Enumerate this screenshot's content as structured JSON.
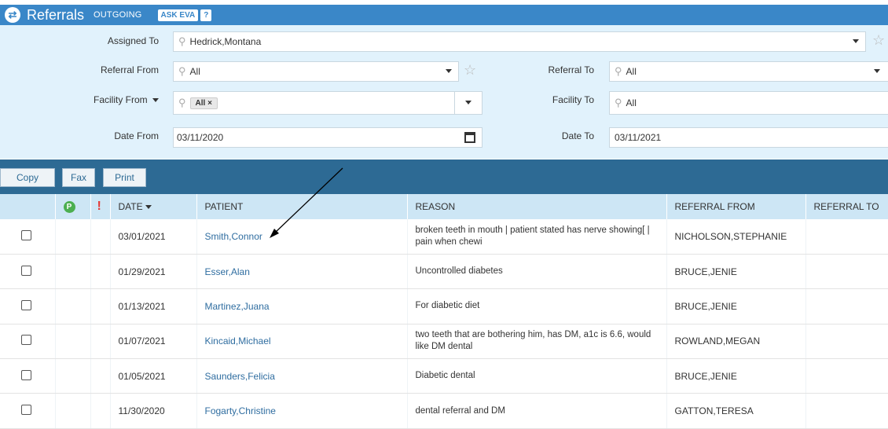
{
  "header": {
    "title": "Referrals",
    "subtitle": "OUTGOING",
    "ask_label": "ASK EVA",
    "help_label": "?",
    "accent": "#3a87c8"
  },
  "filters": {
    "assigned_to": {
      "label": "Assigned To",
      "value": "Hedrick,Montana"
    },
    "referral_from": {
      "label": "Referral From",
      "value": "All"
    },
    "referral_to": {
      "label": "Referral To",
      "value": "All"
    },
    "facility_from": {
      "label": "Facility From",
      "chip": "All"
    },
    "facility_to": {
      "label": "Facility To",
      "value": "All"
    },
    "date_from": {
      "label": "Date From",
      "value": "03/11/2020"
    },
    "date_to": {
      "label": "Date To",
      "value": "03/11/2021"
    }
  },
  "toolbar": {
    "copy": "Copy",
    "fax": "Fax",
    "print": "Print"
  },
  "table": {
    "columns": {
      "priority": "P",
      "urgent": "!",
      "date": "DATE",
      "patient": "PATIENT",
      "reason": "REASON",
      "referral_from": "REFERRAL FROM",
      "referral_to": "REFERRAL TO"
    },
    "rows": [
      {
        "date": "03/01/2021",
        "patient": "Smith,Connor",
        "reason": "broken teeth in mouth | patient stated has nerve showing[ | pain when chewi",
        "referral_from": "NICHOLSON,STEPHANIE",
        "referral_to": ""
      },
      {
        "date": "01/29/2021",
        "patient": "Esser,Alan",
        "reason": "Uncontrolled diabetes",
        "referral_from": "BRUCE,JENIE",
        "referral_to": ""
      },
      {
        "date": "01/13/2021",
        "patient": "Martinez,Juana",
        "reason": "For diabetic diet",
        "referral_from": "BRUCE,JENIE",
        "referral_to": ""
      },
      {
        "date": "01/07/2021",
        "patient": "Kincaid,Michael",
        "reason": "two teeth that are bothering him, has DM, a1c is 6.6, would like DM dental",
        "referral_from": "ROWLAND,MEGAN",
        "referral_to": ""
      },
      {
        "date": "01/05/2021",
        "patient": "Saunders,Felicia",
        "reason": "Diabetic dental",
        "referral_from": "BRUCE,JENIE",
        "referral_to": ""
      },
      {
        "date": "11/30/2020",
        "patient": "Fogarty,Christine",
        "reason": "dental referral and DM",
        "referral_from": "GATTON,TERESA",
        "referral_to": ""
      }
    ]
  }
}
